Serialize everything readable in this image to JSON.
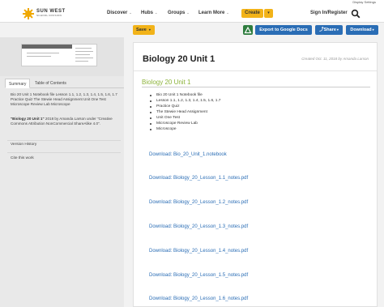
{
  "util": {
    "display_settings": "Display Settings"
  },
  "nav": {
    "logo_line1": "SUN WEST",
    "logo_line2": "SCHOOL DIVISION",
    "discover": "Discover",
    "hubs": "Hubs",
    "groups": "Groups",
    "learn_more": "Learn More",
    "create": "Create",
    "signin": "Sign In/Register"
  },
  "toolbar": {
    "save": "Save",
    "export_google": "Export to Google Docs",
    "share": "Share",
    "download": "Download"
  },
  "sidebar": {
    "tabs": [
      "Summary",
      "Table of Contents"
    ],
    "summary": "Bio 20 Unit 1 Notebook file Lesson 1.1, 1.2, 1.3, 1.4, 1.5, 1.6, 1.7 Practice Quiz The Stewie Head Assignment Unit One Test Microscope Review Lab Microscope",
    "license_title": "\"Biology 20 Unit 1\"",
    "license_rest": " 2018 by Amanda Larson under \"Creative Commons Attribution NonCommercial ShareAlike 4.0\".",
    "version_history": "Version History",
    "cite": "Cite this work"
  },
  "doc": {
    "title": "Biology 20 Unit 1",
    "meta": "Created Oct. 11, 2018 by  Amanda Larson",
    "section_heading": "Biology 20 Unit 1",
    "bullets": [
      "Bio 20 Unit 1 Notebook file",
      "Lesson 1.1, 1.2, 1.3, 1.4, 1.5, 1.6, 1.7",
      "Practice Quiz",
      "The Stewie Head Assignment",
      "Unit One Test",
      "Microscope Review Lab",
      "Microscope"
    ],
    "download_label": "Download:",
    "files": [
      "Bio_20_Unit_1.notebook",
      "Biology_20_Lesson_1.1_notes.pdf",
      "Biology_20_Lesson_1.2_notes.pdf",
      "Biology_20_Lesson_1.3_notes.pdf",
      "Biology_20_Lesson_1.4_notes.pdf",
      "Biology_20_Lesson_1.5_notes.pdf",
      "Biology_20_Lesson_1.6_notes.pdf"
    ]
  },
  "colors": {
    "accent": "#f2b319",
    "link": "#2a6db5",
    "heading_green": "#8cb33a",
    "drive_green": "#2f7d3f"
  }
}
